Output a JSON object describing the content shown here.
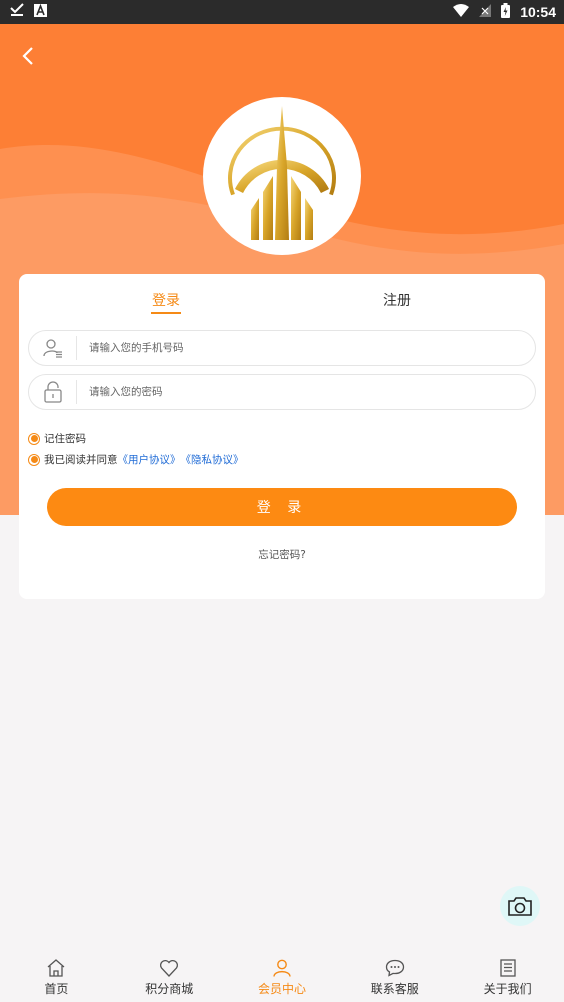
{
  "status_bar": {
    "time": "10:54",
    "left_icons": [
      "check-download-icon",
      "a-app-icon"
    ],
    "right_icons": [
      "wifi-icon",
      "signal-icon",
      "battery-icon"
    ]
  },
  "colors": {
    "brand_orange": "#fd7f35",
    "accent": "#f58a16",
    "button": "#fd8a12",
    "link": "#1f6bd6"
  },
  "login": {
    "tabs": [
      {
        "label": "登录",
        "active": true
      },
      {
        "label": "注册",
        "active": false
      }
    ],
    "phone_placeholder": "请输入您的手机号码",
    "password_placeholder": "请输入您的密码",
    "remember_label": "记住密码",
    "agree_prefix": "我已阅读并同意",
    "user_agreement": "《用户协议》",
    "privacy_agreement": "《隐私协议》",
    "login_button": "登 录",
    "forgot_password": "忘记密码?"
  },
  "nav": {
    "items": [
      {
        "label": "首页",
        "icon": "home-icon",
        "active": false
      },
      {
        "label": "积分商城",
        "icon": "heart-icon",
        "active": false
      },
      {
        "label": "会员中心",
        "icon": "user-icon",
        "active": true
      },
      {
        "label": "联系客服",
        "icon": "chat-icon",
        "active": false
      },
      {
        "label": "关于我们",
        "icon": "document-icon",
        "active": false
      }
    ]
  }
}
